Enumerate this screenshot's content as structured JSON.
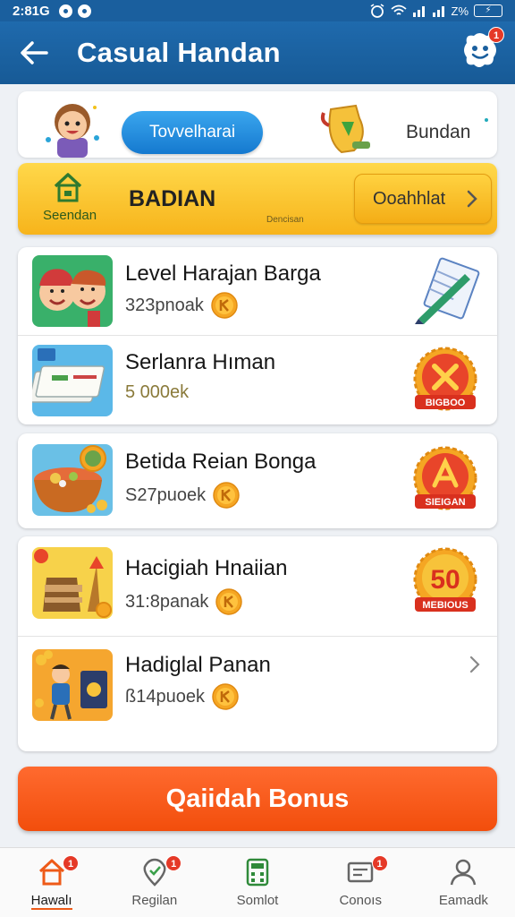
{
  "status_bar": {
    "time": "2:81G",
    "battery": "Z%"
  },
  "app_bar": {
    "title": "Casual Handan",
    "bot_badge": "1"
  },
  "top_card": {
    "button_label": "Tovvelharai",
    "side_label": "Bundan"
  },
  "banner": {
    "title": "BADIAN",
    "sub_label": "Seendan",
    "tiny_text": "Dencisan",
    "button_label": "Ooahhlat"
  },
  "tasks": [
    {
      "name": "Level Harajan Barga",
      "reward": "323pnoak",
      "badge": null
    },
    {
      "name": "Serlanra Hıman",
      "reward": "5 000ek",
      "badge": "BIGBOO"
    },
    {
      "name": "Betida Reian Bonga",
      "reward": "S27puoek",
      "badge": "SIEIGAN"
    },
    {
      "name": "Hacigiah Hnaiian",
      "reward": "31:8panak",
      "badge_number": "50",
      "badge": "MEBIOUS"
    },
    {
      "name": "Hadiglal Panan",
      "reward": "ß14puoek",
      "badge": null
    }
  ],
  "bonus_button": "Qaiidah Bonus",
  "nav": [
    {
      "label": "Hawalı",
      "badge": "1",
      "active": true
    },
    {
      "label": "Regilan",
      "badge": "1",
      "active": false
    },
    {
      "label": "Somlot",
      "badge": null,
      "active": false
    },
    {
      "label": "Conoıs",
      "badge": "1",
      "active": false
    },
    {
      "label": "Eamadk",
      "badge": null,
      "active": false
    }
  ],
  "colors": {
    "primary": "#1a5f9e",
    "accent": "#f24e0c",
    "banner": "#f7b41b",
    "coin": "#f5a623"
  }
}
